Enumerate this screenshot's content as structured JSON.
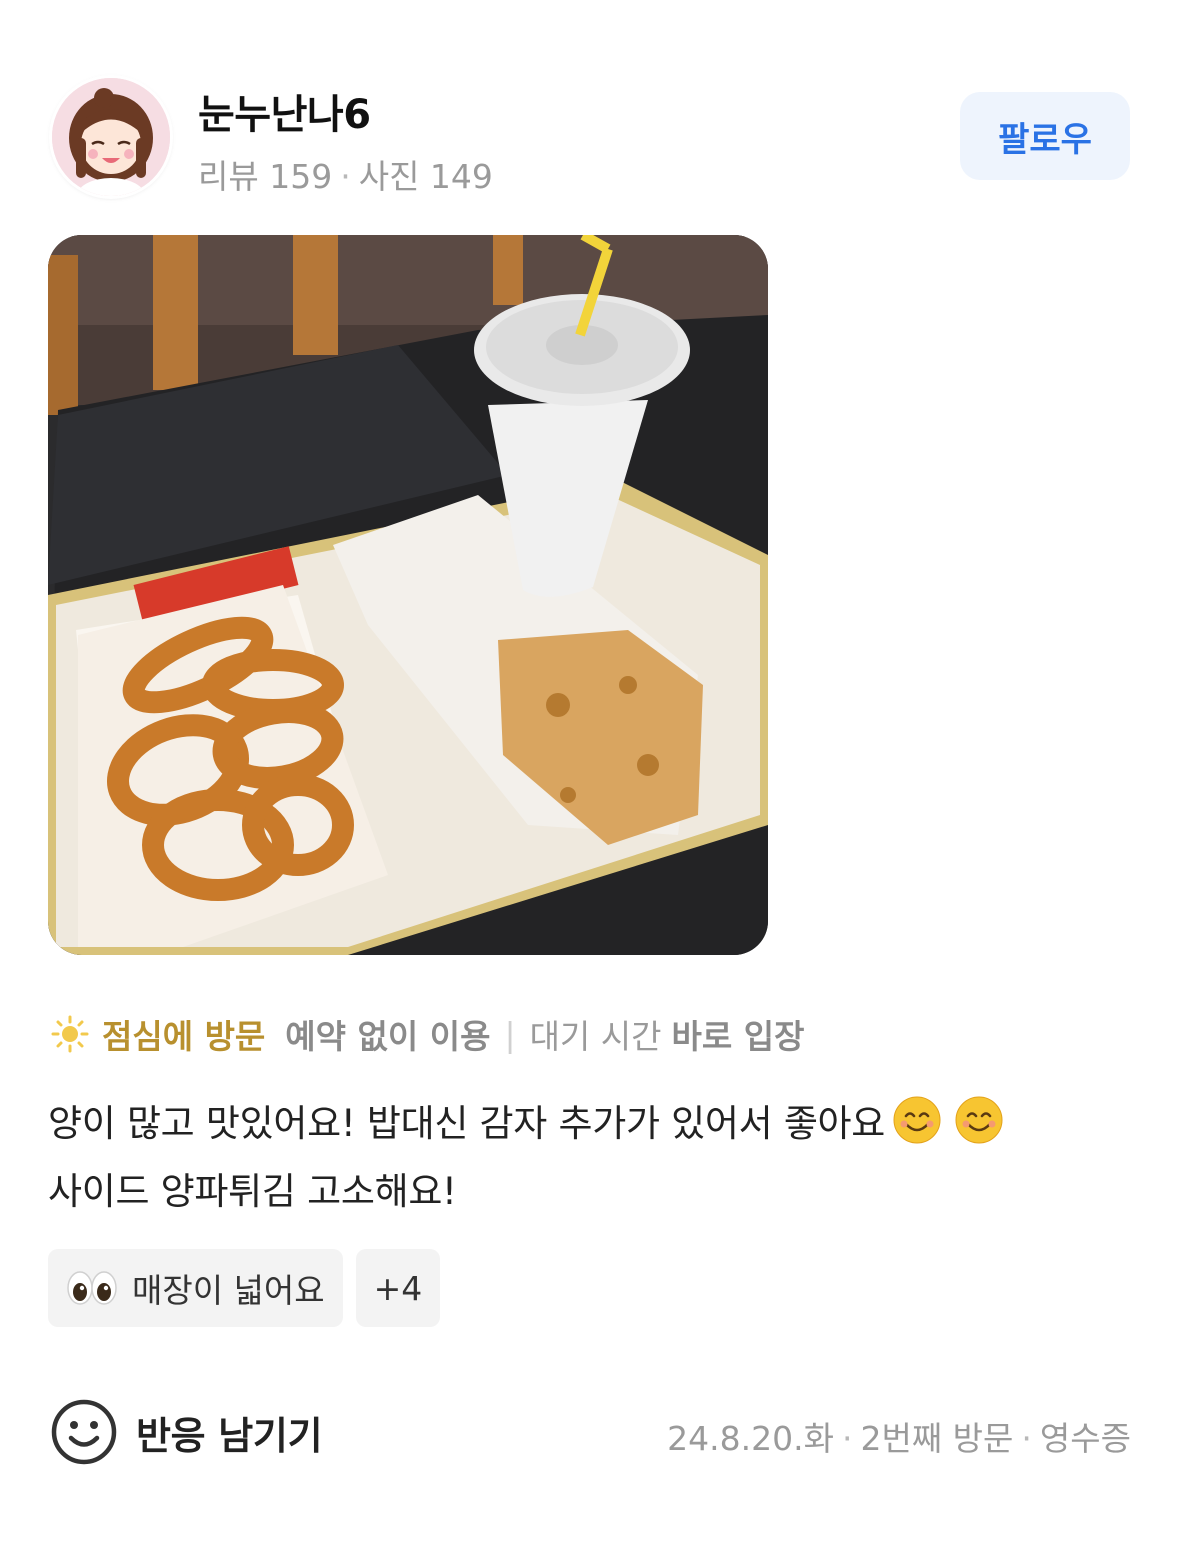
{
  "user": {
    "name": "눈누난나6",
    "review_label": "리뷰 159",
    "photo_label": "사진 149",
    "separator": "·",
    "follow_label": "팔로우"
  },
  "visit": {
    "time": "점심에 방문",
    "reservation": "예약 없이 이용",
    "divider": "|",
    "wait_label": "대기 시간",
    "wait_value": "바로 입장",
    "icon": "sun-icon"
  },
  "review": {
    "line1": "양이 많고 맛있어요! 밥대신 감자 추가가 있어서 좋아요",
    "line1_emojis": [
      "smiling-face-emoji",
      "smiling-face-emoji"
    ],
    "line2": "사이드 양파튀김 고소해요!"
  },
  "tags": [
    {
      "label": "매장이 넓어요",
      "icon": "eyes-emoji"
    },
    {
      "label": "+4"
    }
  ],
  "footer": {
    "react_label": "반응 남기기",
    "react_icon": "smile-icon",
    "date": "24.8.20.화",
    "visit_count": "2번째 방문",
    "receipt": "영수증",
    "separator": "·"
  },
  "colors": {
    "accent_blue": "#2a72e5",
    "follow_bg": "#eef4fd",
    "visit_gold": "#b8902e",
    "muted": "#9a9a9a"
  }
}
